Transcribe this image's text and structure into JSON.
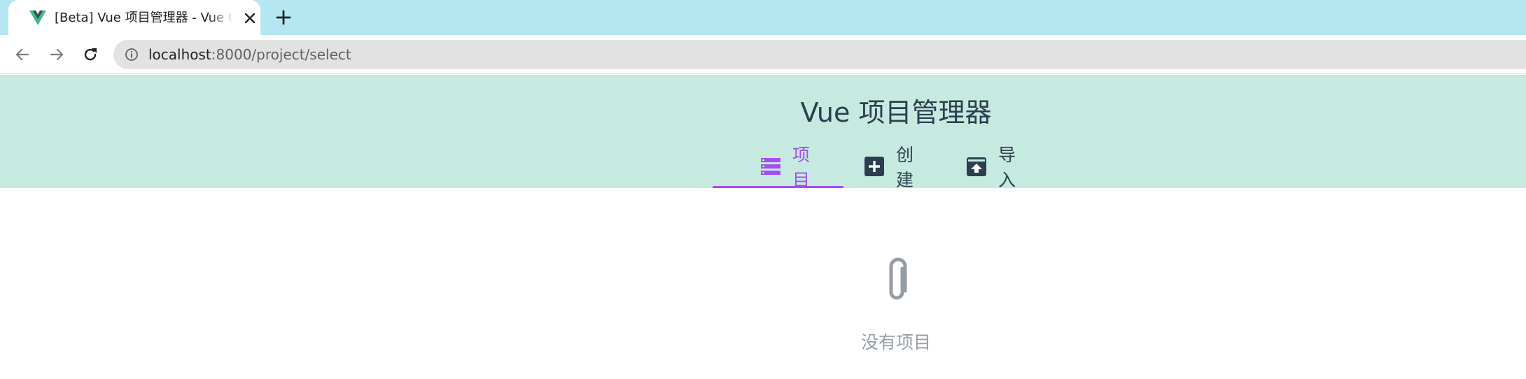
{
  "browser": {
    "tab": {
      "title": "[Beta] Vue 项目管理器 - Vue CLI",
      "favicon": "vue-logo-icon",
      "close_icon": "close-icon"
    },
    "new_tab_icon": "plus-icon",
    "nav": {
      "back_icon": "arrow-left-icon",
      "forward_icon": "arrow-right-icon",
      "reload_icon": "reload-icon"
    },
    "address": {
      "info_icon": "info-icon",
      "host": "localhost",
      "rest": ":8000/project/select"
    }
  },
  "app": {
    "title": "Vue 项目管理器",
    "tabs": [
      {
        "label": "项目",
        "icon": "list-icon",
        "selected": true
      },
      {
        "label": "创建",
        "icon": "add-box-icon",
        "selected": false
      },
      {
        "label": "导入",
        "icon": "unarchive-icon",
        "selected": false
      }
    ],
    "empty": {
      "icon": "paperclip-icon",
      "label": "没有项目"
    }
  },
  "colors": {
    "tabstrip": "#b4e7f2",
    "header": "#c6eadf",
    "accent": "#a44cf6",
    "text": "#2c3e50",
    "muted": "#959ca3"
  }
}
